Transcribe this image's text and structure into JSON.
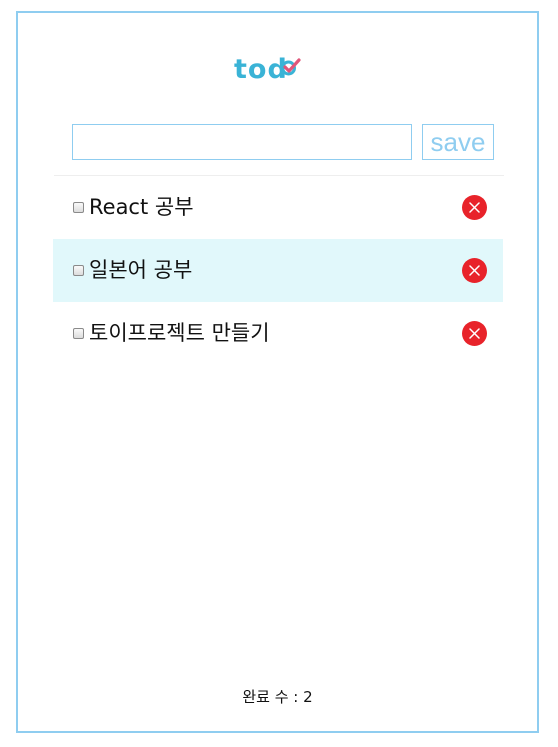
{
  "header": {
    "logo_text": "tod"
  },
  "form": {
    "input_value": "",
    "input_placeholder": "",
    "save_label": "save"
  },
  "todos": [
    {
      "text": "React 공부",
      "checked": false,
      "highlighted": false
    },
    {
      "text": "일본어 공부",
      "checked": false,
      "highlighted": true
    },
    {
      "text": "토이프로젝트 만들기",
      "checked": false,
      "highlighted": false
    }
  ],
  "footer": {
    "completed_label": "완료 수 : 2"
  },
  "colors": {
    "accent": "#3ab3d6",
    "border": "#8fcdf0",
    "highlight_row": "#e1f8fb",
    "delete": "#e8232a",
    "logo_check": "#e0567a"
  },
  "icons": {
    "delete": "close-circle-icon",
    "logo_mark": "checkmark-icon"
  }
}
